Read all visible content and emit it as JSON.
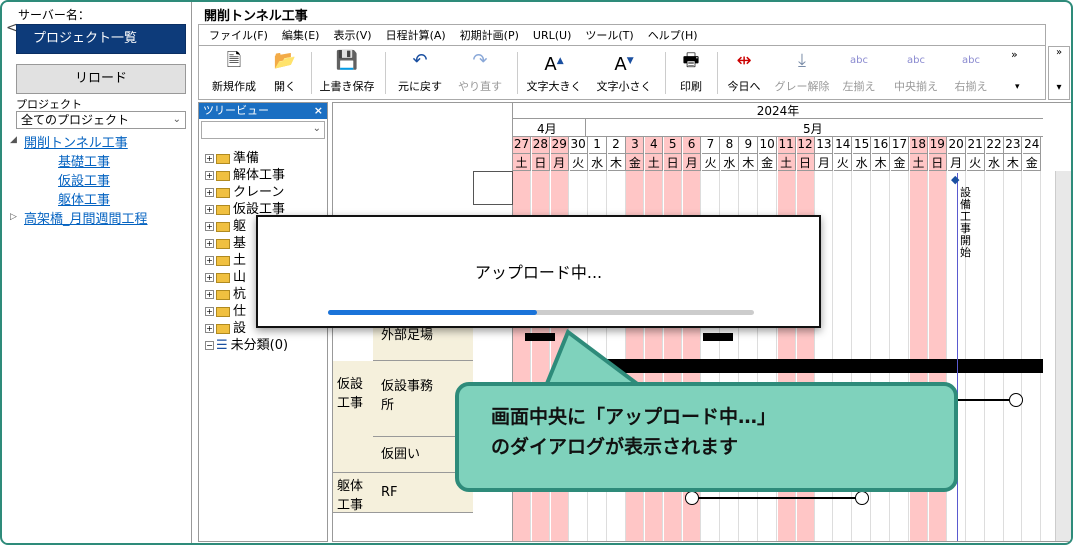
{
  "left_panel": {
    "server_label": "サーバー名：",
    "back_glyph": "<",
    "projects_button": "プロジェクト一覧",
    "reload_button": "リロード",
    "project_label": "プロジェクト",
    "project_select": "全てのプロジェクト",
    "tree": [
      {
        "label": "開削トンネル工事",
        "expanded": true
      },
      {
        "label": "基礎工事"
      },
      {
        "label": "仮設工事"
      },
      {
        "label": "躯体工事"
      },
      {
        "label": "高架橋_月間週間工程",
        "expanded": false
      }
    ]
  },
  "window": {
    "title": "開削トンネル工事",
    "menu": [
      "ファイル(F)",
      "編集(E)",
      "表示(V)",
      "日程計算(A)",
      "初期計画(P)",
      "URL(U)",
      "ツール(T)",
      "ヘルプ(H)"
    ],
    "toolbar": [
      {
        "label": "新規作成",
        "icon": "new-doc-icon",
        "enabled": true
      },
      {
        "label": "開く",
        "icon": "open-folder-icon",
        "enabled": true
      },
      {
        "label": "上書き保存",
        "icon": "save-icon",
        "enabled": true
      },
      {
        "label": "元に戻す",
        "icon": "undo-icon",
        "enabled": true
      },
      {
        "label": "やり直す",
        "icon": "redo-icon",
        "enabled": false
      },
      {
        "label": "文字大きく",
        "icon": "font-larger-icon",
        "enabled": true
      },
      {
        "label": "文字小さく",
        "icon": "font-smaller-icon",
        "enabled": true
      },
      {
        "label": "印刷",
        "icon": "print-icon",
        "enabled": true
      },
      {
        "label": "今日へ",
        "icon": "today-icon",
        "enabled": true
      },
      {
        "label": "グレー解除",
        "icon": "gray-clear-icon",
        "enabled": false
      },
      {
        "label": "左揃え",
        "icon": "align-left-icon",
        "enabled": false
      },
      {
        "label": "中央揃え",
        "icon": "align-center-icon",
        "enabled": false
      },
      {
        "label": "右揃え",
        "icon": "align-right-icon",
        "enabled": false
      }
    ],
    "toolbar_overflow": "»"
  },
  "treeview": {
    "title": "ツリービュー",
    "close": "×",
    "items": [
      "準備",
      "解体工事",
      "クレーン",
      "仮設工事",
      "躯",
      "基",
      "土",
      "山",
      "杭",
      "仕",
      "設",
      "未分類(0)"
    ]
  },
  "schedule": {
    "year": "2024年",
    "months": [
      {
        "label": "4月"
      },
      {
        "label": "5月"
      }
    ],
    "days": [
      {
        "d": "27",
        "w": "土",
        "hol": true
      },
      {
        "d": "28",
        "w": "日",
        "hol": true
      },
      {
        "d": "29",
        "w": "月",
        "hol": true
      },
      {
        "d": "30",
        "w": "火",
        "hol": false
      },
      {
        "d": "1",
        "w": "水",
        "hol": false
      },
      {
        "d": "2",
        "w": "木",
        "hol": false
      },
      {
        "d": "3",
        "w": "金",
        "hol": true
      },
      {
        "d": "4",
        "w": "土",
        "hol": true
      },
      {
        "d": "5",
        "w": "日",
        "hol": true
      },
      {
        "d": "6",
        "w": "月",
        "hol": true
      },
      {
        "d": "7",
        "w": "火",
        "hol": false
      },
      {
        "d": "8",
        "w": "水",
        "hol": false
      },
      {
        "d": "9",
        "w": "木",
        "hol": false
      },
      {
        "d": "10",
        "w": "金",
        "hol": false
      },
      {
        "d": "11",
        "w": "土",
        "hol": true
      },
      {
        "d": "12",
        "w": "日",
        "hol": true
      },
      {
        "d": "13",
        "w": "月",
        "hol": false
      },
      {
        "d": "14",
        "w": "火",
        "hol": false
      },
      {
        "d": "15",
        "w": "水",
        "hol": false
      },
      {
        "d": "16",
        "w": "木",
        "hol": false
      },
      {
        "d": "17",
        "w": "金",
        "hol": false
      },
      {
        "d": "18",
        "w": "土",
        "hol": true
      },
      {
        "d": "19",
        "w": "日",
        "hol": true
      },
      {
        "d": "20",
        "w": "月",
        "hol": false
      },
      {
        "d": "21",
        "w": "火",
        "hol": false
      },
      {
        "d": "22",
        "w": "水",
        "hol": false
      },
      {
        "d": "23",
        "w": "木",
        "hol": false
      },
      {
        "d": "24",
        "w": "金",
        "hol": false
      }
    ],
    "milestone": "設備工事開始",
    "rows": {
      "outer_scaffold": "外部足場",
      "temp_works": "仮設\n工事",
      "temp_office": "仮設事務\n所",
      "temp_fence": "仮囲い",
      "structure": "躯体\n工事",
      "rf": "RF"
    }
  },
  "dialog": {
    "text": "アップロード中...",
    "progress": 0.49,
    "progress_color": "#1a73d9"
  },
  "callout": {
    "text": "画面中央に「アップロード中…」\nのダイアログが表示されます",
    "color": "#7fd2bc",
    "border": "#2e8b7a"
  }
}
